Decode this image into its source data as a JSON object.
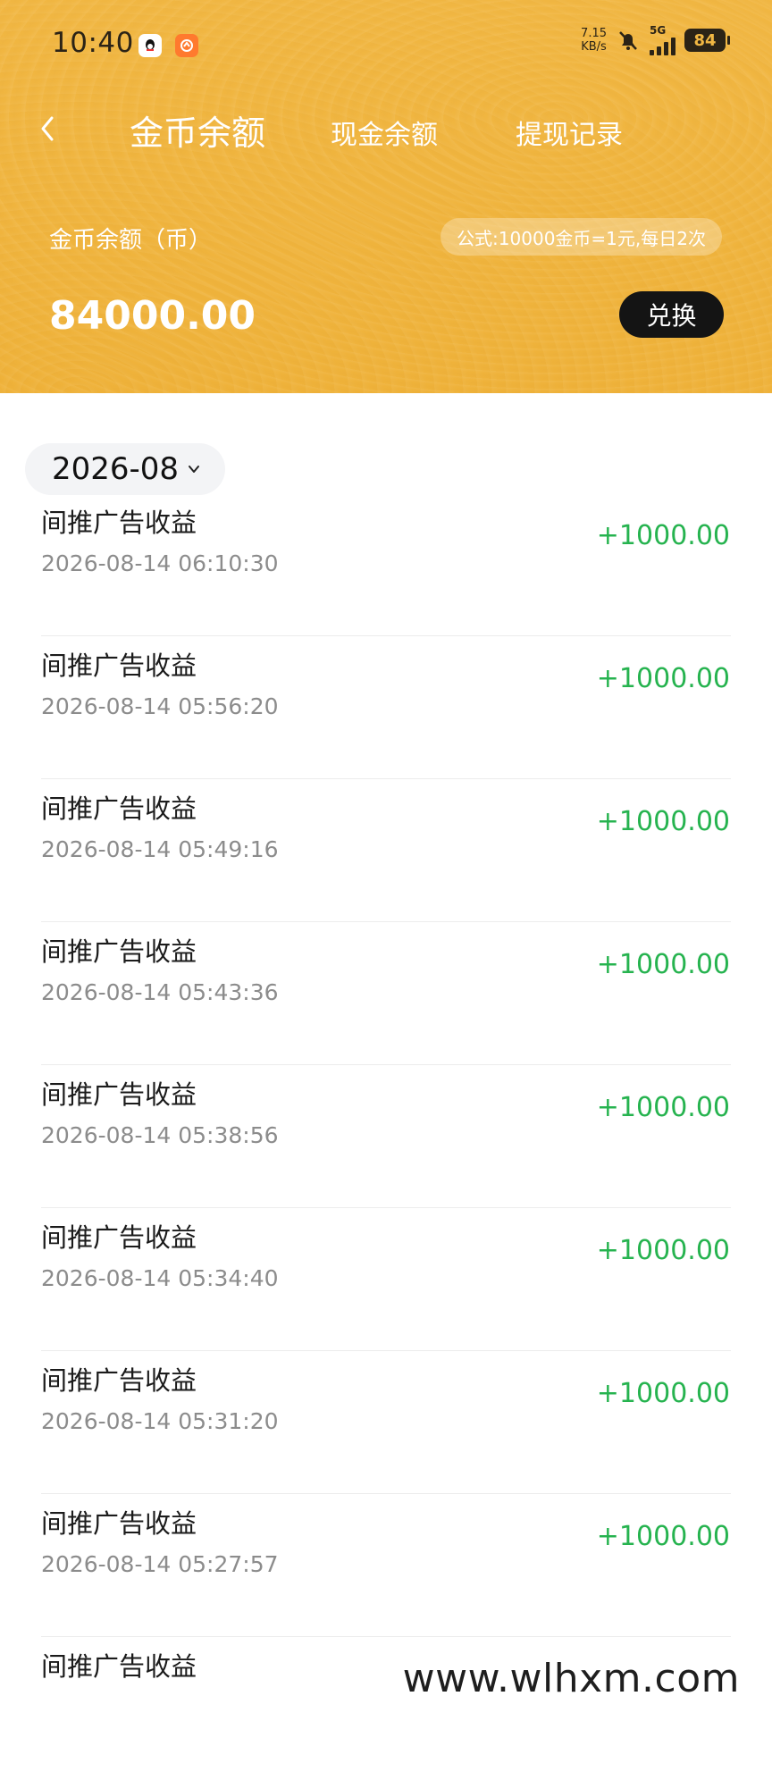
{
  "status_bar": {
    "time": "10:40",
    "net_speed": "7.15",
    "net_unit": "KB/s",
    "network": "5G",
    "battery": "84",
    "icons": [
      "qq-icon",
      "orange-app-icon",
      "mute-bell-icon",
      "signal-icon",
      "battery-icon"
    ]
  },
  "nav": {
    "back_icon": "chevron-left-icon",
    "tabs": [
      {
        "label": "金币余额",
        "active": true
      },
      {
        "label": "现金余额",
        "active": false
      },
      {
        "label": "提现记录",
        "active": false
      }
    ]
  },
  "balance": {
    "label": "金币余额（币）",
    "formula": "公式:10000金币=1元,每日2次",
    "value": "84000.00",
    "exchange_label": "兑换"
  },
  "filter": {
    "month": "2026-08"
  },
  "transactions": [
    {
      "title": "间推广告收益",
      "time": "2026-08-14 06:10:30",
      "amount": "+1000.00"
    },
    {
      "title": "间推广告收益",
      "time": "2026-08-14 05:56:20",
      "amount": "+1000.00"
    },
    {
      "title": "间推广告收益",
      "time": "2026-08-14 05:49:16",
      "amount": "+1000.00"
    },
    {
      "title": "间推广告收益",
      "time": "2026-08-14 05:43:36",
      "amount": "+1000.00"
    },
    {
      "title": "间推广告收益",
      "time": "2026-08-14 05:38:56",
      "amount": "+1000.00"
    },
    {
      "title": "间推广告收益",
      "time": "2026-08-14 05:34:40",
      "amount": "+1000.00"
    },
    {
      "title": "间推广告收益",
      "time": "2026-08-14 05:31:20",
      "amount": "+1000.00"
    },
    {
      "title": "间推广告收益",
      "time": "2026-08-14 05:27:57",
      "amount": "+1000.00"
    },
    {
      "title": "间推广告收益",
      "time": "",
      "amount": ""
    }
  ],
  "watermark": "www.wlhxm.com",
  "colors": {
    "header": "#f1b743",
    "positive": "#26b34f",
    "button": "#141414"
  }
}
